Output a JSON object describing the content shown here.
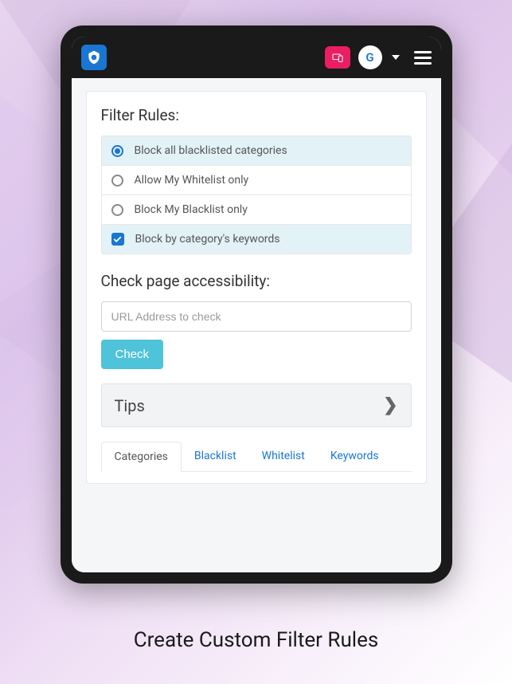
{
  "header": {
    "avatar_initial": "G"
  },
  "filter": {
    "title": "Filter Rules:",
    "options": [
      {
        "label": "Block all blacklisted categories",
        "type": "radio",
        "selected": true,
        "highlight": true
      },
      {
        "label": "Allow My Whitelist only",
        "type": "radio",
        "selected": false,
        "highlight": false
      },
      {
        "label": "Block My Blacklist only",
        "type": "radio",
        "selected": false,
        "highlight": false
      },
      {
        "label": "Block by category's keywords",
        "type": "checkbox",
        "selected": true,
        "highlight": true
      }
    ]
  },
  "accessibility": {
    "title": "Check page accessibility:",
    "url_placeholder": "URL Address to check",
    "check_label": "Check"
  },
  "tips": {
    "label": "Tips"
  },
  "tabs": {
    "items": [
      {
        "label": "Categories",
        "active": true
      },
      {
        "label": "Blacklist",
        "active": false
      },
      {
        "label": "Whitelist",
        "active": false
      },
      {
        "label": "Keywords",
        "active": false
      }
    ]
  },
  "caption": "Create Custom Filter Rules",
  "colors": {
    "accent_blue": "#1976d2",
    "button_teal": "#4fc3d9",
    "pink": "#e91e63",
    "highlight": "#e3f2f7"
  }
}
